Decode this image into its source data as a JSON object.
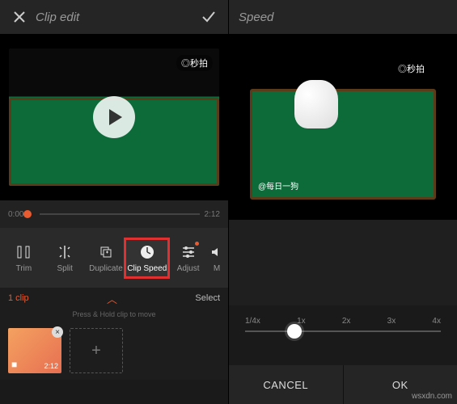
{
  "left": {
    "header": {
      "title": "Clip edit"
    },
    "preview": {
      "watermark": "◎秒拍"
    },
    "timeline": {
      "start": "0:00",
      "end": "2:12",
      "track_label": ""
    },
    "tools": [
      {
        "id": "trim",
        "label": "Trim"
      },
      {
        "id": "split",
        "label": "Split"
      },
      {
        "id": "duplicate",
        "label": "Duplicate"
      },
      {
        "id": "clipspeed",
        "label": "Clip Speed",
        "active": true
      },
      {
        "id": "adjust",
        "label": "Adjust"
      },
      {
        "id": "more",
        "label": "M"
      }
    ],
    "cliprow": {
      "count_label": "1 clip",
      "select_label": "Select",
      "hint": "Press & Hold clip to move",
      "thumb_duration": "2:12"
    }
  },
  "right": {
    "header": {
      "title": "Speed"
    },
    "preview": {
      "watermark_top": "◎秒拍",
      "watermark_bot": "@每日一狗"
    },
    "speed": {
      "ticks": [
        "1/4x",
        "1x",
        "2x",
        "3x",
        "4x"
      ],
      "value_index": 1
    },
    "buttons": {
      "cancel": "CANCEL",
      "ok": "OK"
    }
  },
  "page_watermark": "wsxdn.com"
}
